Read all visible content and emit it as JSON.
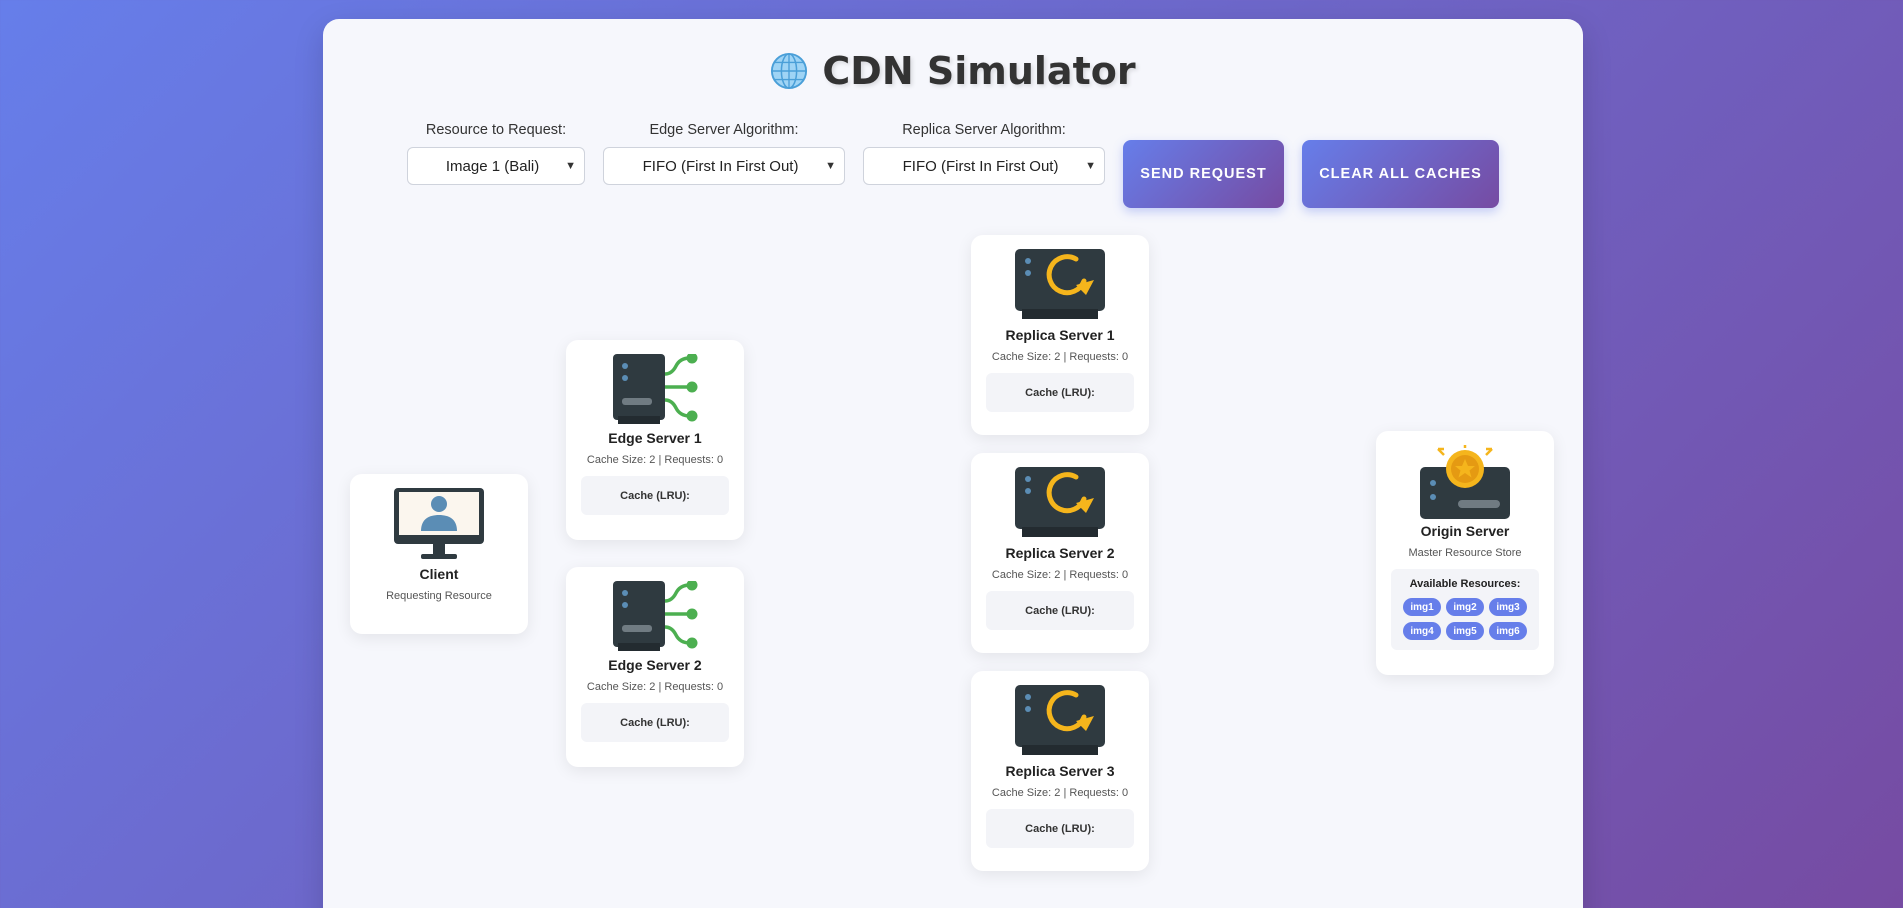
{
  "header": {
    "title": "CDN Simulator"
  },
  "controls": {
    "resource": {
      "label": "Resource to Request:",
      "selected": "Image 1 (Bali)"
    },
    "edge_algorithm": {
      "label": "Edge Server Algorithm:",
      "selected": "FIFO (First In First Out)"
    },
    "replica_algorithm": {
      "label": "Replica Server Algorithm:",
      "selected": "FIFO (First In First Out)"
    },
    "send_label": "SEND REQUEST",
    "clear_label": "CLEAR ALL CACHES"
  },
  "client": {
    "name": "Client",
    "subtitle": "Requesting Resource"
  },
  "edges": [
    {
      "name": "Edge Server 1",
      "meta": "Cache Size: 2 | Requests: 0",
      "cache": "Cache (LRU):"
    },
    {
      "name": "Edge Server 2",
      "meta": "Cache Size: 2 | Requests: 0",
      "cache": "Cache (LRU):"
    }
  ],
  "replicas": [
    {
      "name": "Replica Server 1",
      "meta": "Cache Size: 2 | Requests: 0",
      "cache": "Cache (LRU):"
    },
    {
      "name": "Replica Server 2",
      "meta": "Cache Size: 2 | Requests: 0",
      "cache": "Cache (LRU):"
    },
    {
      "name": "Replica Server 3",
      "meta": "Cache Size: 2 | Requests: 0",
      "cache": "Cache (LRU):"
    }
  ],
  "origin": {
    "name": "Origin Server",
    "subtitle": "Master Resource Store",
    "resources_title": "Available Resources:",
    "resources": [
      "img1",
      "img2",
      "img3",
      "img4",
      "img5",
      "img6"
    ]
  },
  "colors": {
    "accent": "#667eea",
    "accent_end": "#764ba2",
    "server_dark": "#2f3a40",
    "edge_green": "#4caf50",
    "replica_gold": "#f5b51c",
    "client_blue": "#5b8db5"
  },
  "icons": {
    "title": "globe-icon",
    "client": "client-monitor-icon",
    "edge": "edge-server-icon",
    "replica": "replica-server-icon",
    "origin": "origin-server-icon",
    "dropdown": "chevron-down-icon"
  }
}
